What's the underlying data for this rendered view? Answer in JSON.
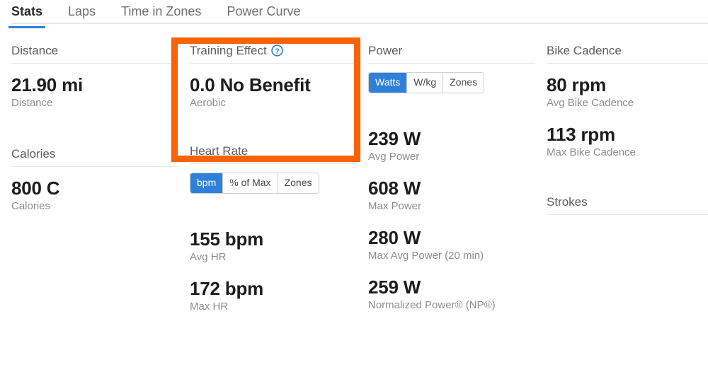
{
  "tabs": [
    {
      "label": "Stats",
      "active": true
    },
    {
      "label": "Laps",
      "active": false
    },
    {
      "label": "Time in Zones",
      "active": false
    },
    {
      "label": "Power Curve",
      "active": false
    }
  ],
  "columns": {
    "col1": {
      "distance": {
        "title": "Distance",
        "value": "21.90 mi",
        "label": "Distance"
      },
      "calories": {
        "title": "Calories",
        "value": "800 C",
        "label": "Calories"
      }
    },
    "col2": {
      "training_effect": {
        "title": "Training Effect",
        "help_icon": "question-mark-circle-icon",
        "value": "0.0 No Benefit",
        "label": "Aerobic"
      },
      "heart_rate": {
        "title": "Heart Rate",
        "toggles": [
          {
            "label": "bpm",
            "selected": true
          },
          {
            "label": "% of Max",
            "selected": false
          },
          {
            "label": "Zones",
            "selected": false
          }
        ],
        "stats": [
          {
            "value": "155 bpm",
            "label": "Avg HR"
          },
          {
            "value": "172 bpm",
            "label": "Max HR"
          }
        ]
      }
    },
    "col3": {
      "power": {
        "title": "Power",
        "toggles": [
          {
            "label": "Watts",
            "selected": true
          },
          {
            "label": "W/kg",
            "selected": false
          },
          {
            "label": "Zones",
            "selected": false
          }
        ],
        "stats": [
          {
            "value": "239 W",
            "label": "Avg Power"
          },
          {
            "value": "608 W",
            "label": "Max Power"
          },
          {
            "value": "280 W",
            "label": "Max Avg Power (20 min)"
          },
          {
            "value": "259 W",
            "label": "Normalized Power® (NP®)"
          }
        ]
      }
    },
    "col4": {
      "bike_cadence": {
        "title": "Bike Cadence",
        "stats": [
          {
            "value": "80 rpm",
            "label": "Avg Bike Cadence"
          },
          {
            "value": "113 rpm",
            "label": "Max Bike Cadence"
          }
        ]
      },
      "strokes": {
        "title": "Strokes"
      }
    }
  },
  "annotation": {
    "highlight_color": "#f96302",
    "target": "training-effect-card"
  },
  "theme": {
    "accent": "#2f80d8",
    "text_primary": "#1d1d1d",
    "text_secondary": "#8a8d8f",
    "rule": "#e6e6e6"
  }
}
